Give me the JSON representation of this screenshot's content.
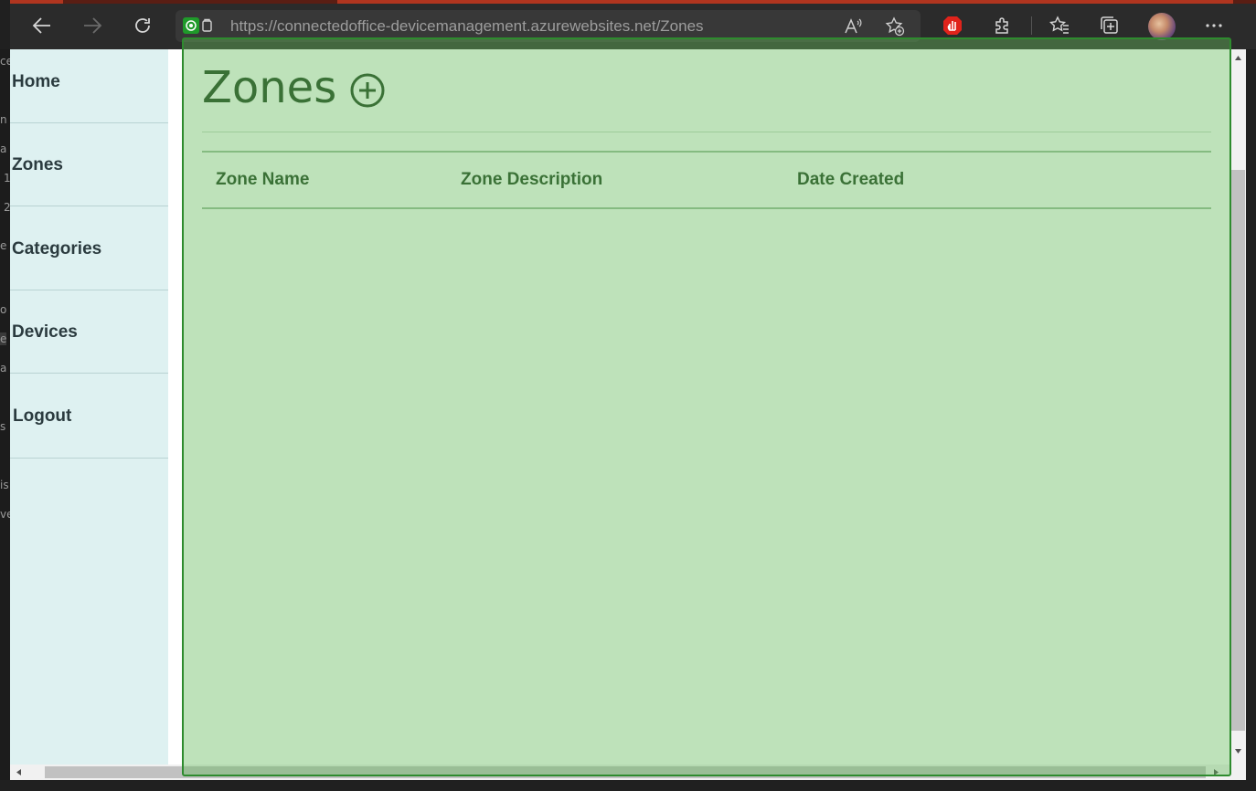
{
  "browser": {
    "url_main": "https://connectedoffice-devicemanagement.azurewebsites.net",
    "url_path": "/Zones",
    "icons": [
      "back-icon",
      "forward-icon",
      "refresh-icon",
      "site-info-icon",
      "read-aloud-icon",
      "add-favorite-icon",
      "adblock-icon",
      "extensions-icon",
      "favorites-icon",
      "collections-icon",
      "profile-avatar",
      "more-icon"
    ]
  },
  "sidebar": {
    "items": [
      {
        "label": "Home"
      },
      {
        "label": "Zones"
      },
      {
        "label": "Categories"
      },
      {
        "label": "Devices"
      },
      {
        "label": "Logout"
      }
    ]
  },
  "page": {
    "title": "Zones",
    "add_icon": "plus-circle-icon"
  },
  "table": {
    "headers": [
      "Zone Name",
      "Zone Description",
      "Date Created"
    ],
    "rows": []
  },
  "background_window": {
    "fragments": [
      "ce",
      "n",
      "a",
      "1",
      "2",
      "e",
      "o",
      "e",
      "a",
      "s",
      "is",
      "ve"
    ]
  },
  "colors": {
    "overlay": "#64b95a",
    "sidebar_bg": "#def1f1",
    "title_text": "#1c3d1c"
  }
}
